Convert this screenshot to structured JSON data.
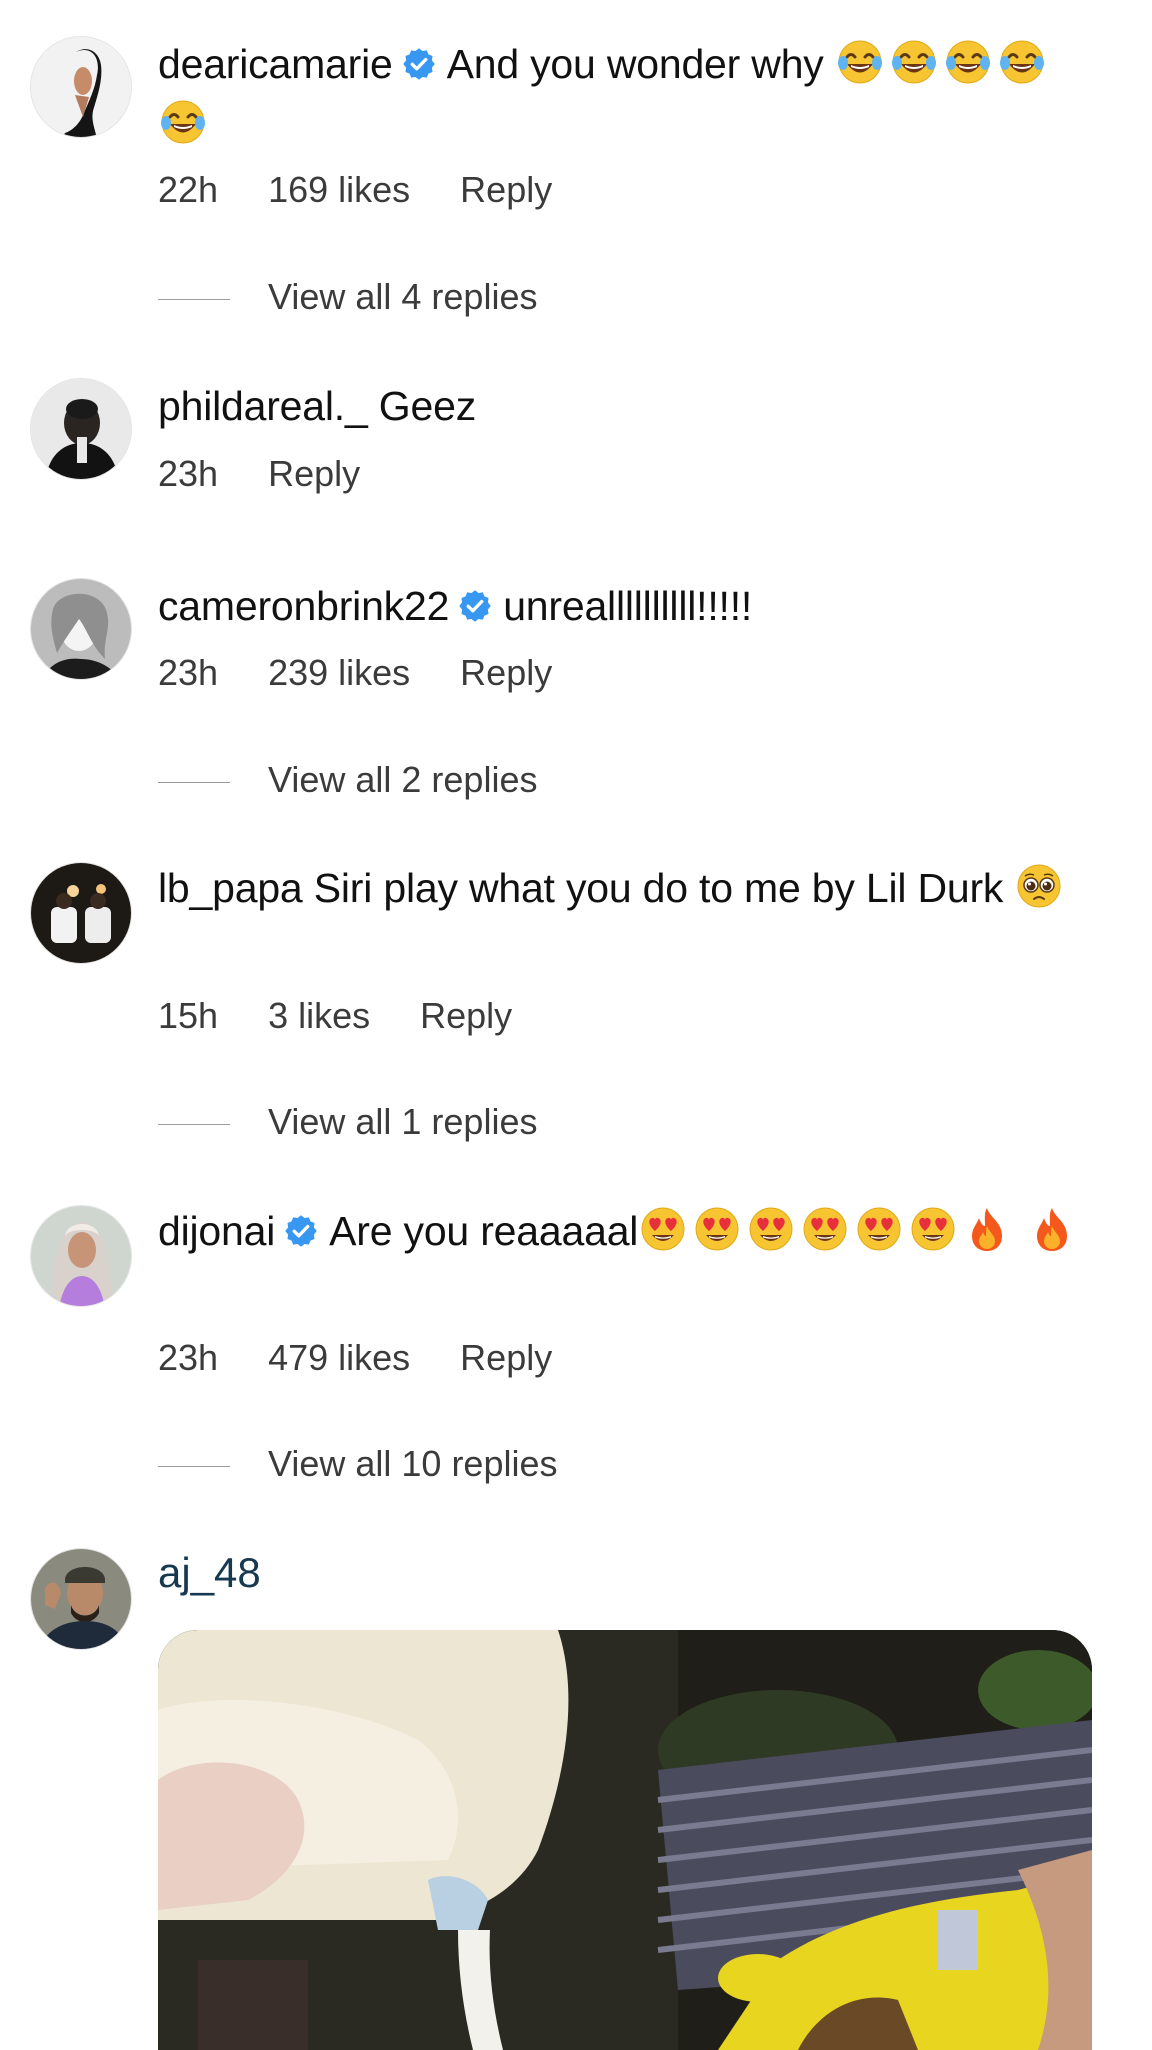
{
  "comments": [
    {
      "username": "dearicamarie",
      "verified": true,
      "text": "And you wonder why",
      "emojis": [
        "face-with-tears-of-joy",
        "face-with-tears-of-joy",
        "face-with-tears-of-joy",
        "face-with-tears-of-joy",
        "face-with-tears-of-joy"
      ],
      "time": "22h",
      "likes": "169 likes",
      "reply": "Reply",
      "view_replies": "View all 4 replies"
    },
    {
      "username": "phildareal._",
      "verified": false,
      "text": "Geez",
      "time": "23h",
      "reply": "Reply"
    },
    {
      "username": "cameronbrink22",
      "verified": true,
      "text": "unreallllllllll!!!!!",
      "time": "23h",
      "likes": "239 likes",
      "reply": "Reply",
      "view_replies": "View all 2 replies"
    },
    {
      "username": "lb_papa",
      "verified": false,
      "text": "Siri play what you do to me by Lil Durk",
      "emojis": [
        "pleading-face"
      ],
      "time": "15h",
      "likes": "3 likes",
      "reply": "Reply",
      "view_replies": "View all 1 replies"
    },
    {
      "username": "dijonai",
      "verified": true,
      "text": "Are you reaaaaal",
      "emojis": [
        "heart-eyes-face",
        "heart-eyes-face",
        "heart-eyes-face",
        "heart-eyes-face",
        "heart-eyes-face",
        "heart-eyes-face",
        "fire",
        "fire"
      ],
      "time": "23h",
      "likes": "479 likes",
      "reply": "Reply",
      "view_replies": "View all 10 replies"
    },
    {
      "username": "aj_48",
      "verified": false,
      "attachment": "gif-image"
    }
  ],
  "colors": {
    "verified_blue": "#3897f0",
    "meta_gray": "#3b3b3b",
    "aj_name": "#16394f"
  }
}
